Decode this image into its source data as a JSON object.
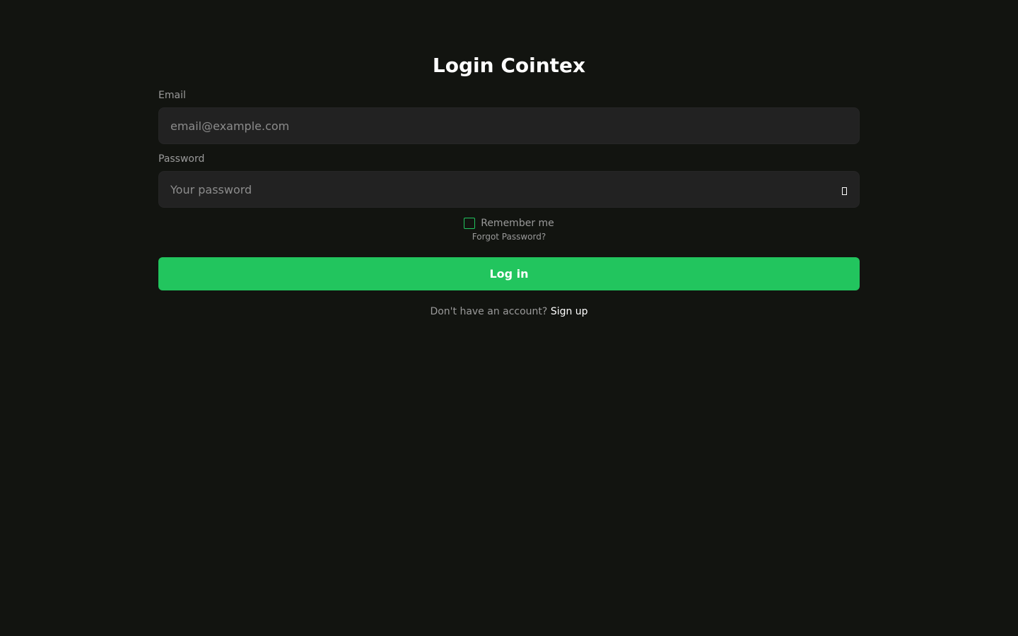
{
  "title": "Login Cointex",
  "email": {
    "label": "Email",
    "placeholder": "email@example.com",
    "value": ""
  },
  "password": {
    "label": "Password",
    "placeholder": "Your password",
    "value": "",
    "toggle_icon": "eye-icon"
  },
  "remember": {
    "label": "Remember me",
    "checked": false
  },
  "forgot_label": "Forgot Password?",
  "login_label": "Log in",
  "signup": {
    "prompt": "Don't have an account?",
    "link_label": "Sign up"
  },
  "colors": {
    "background": "#121410",
    "accent": "#22c55e",
    "input_bg": "#222222"
  }
}
